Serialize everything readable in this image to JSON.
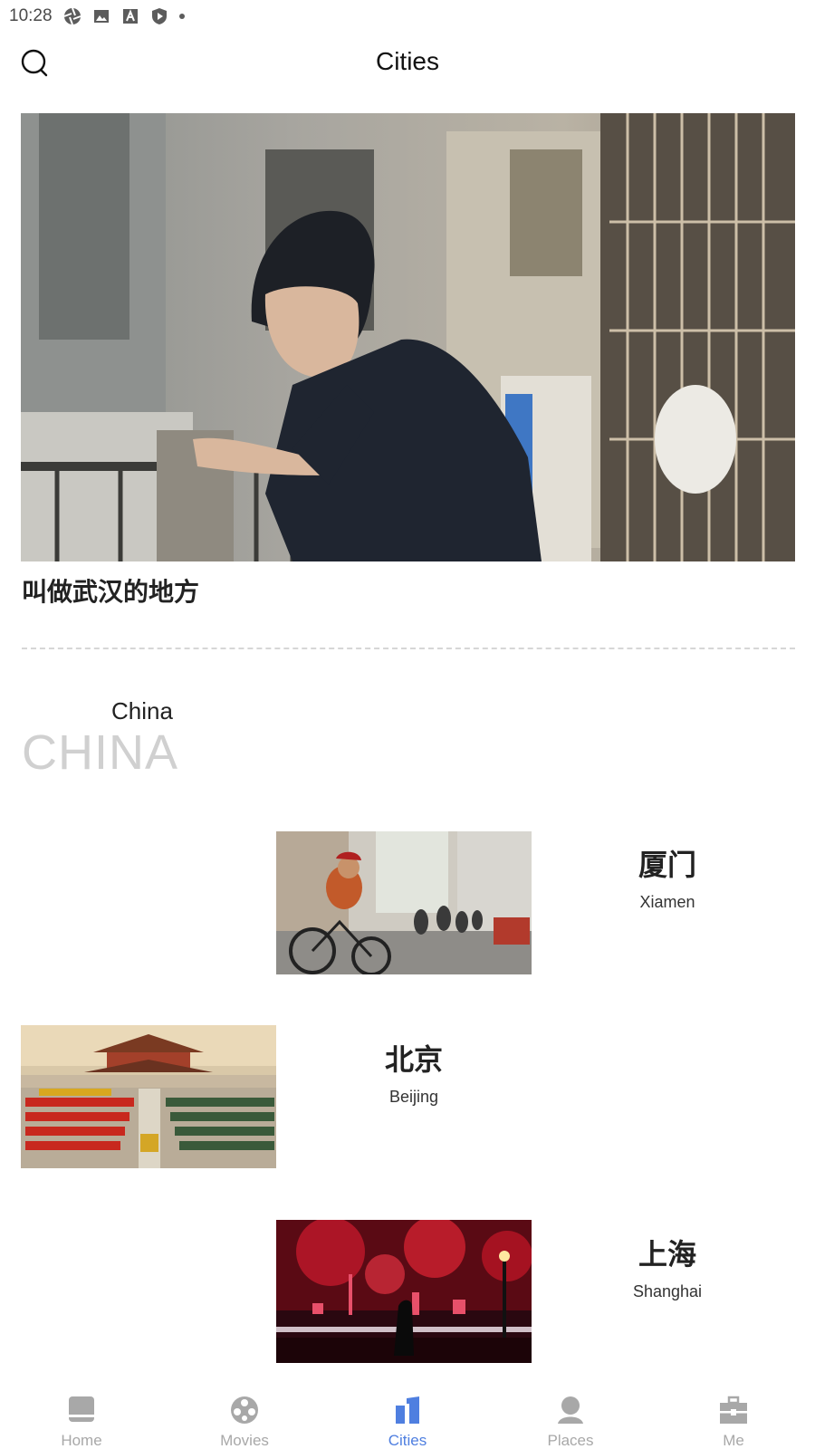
{
  "status_bar": {
    "time": "10:28",
    "icons": [
      "aperture-icon",
      "image-icon",
      "font-a-icon",
      "shield-icon",
      "dot-icon"
    ]
  },
  "header": {
    "title": "Cities",
    "search_icon": "search-icon"
  },
  "hero": {
    "caption": "叫做武汉的地方"
  },
  "section": {
    "label": "China",
    "watermark": "CHINA"
  },
  "cities": [
    {
      "name_cn": "厦门",
      "name_en": "Xiamen"
    },
    {
      "name_cn": "北京",
      "name_en": "Beijing"
    },
    {
      "name_cn": "上海",
      "name_en": "Shanghai"
    }
  ],
  "nav": {
    "items": [
      {
        "label": "Home",
        "icon": "home-icon"
      },
      {
        "label": "Movies",
        "icon": "film-reel-icon"
      },
      {
        "label": "Cities",
        "icon": "cities-icon"
      },
      {
        "label": "Places",
        "icon": "person-pin-icon"
      },
      {
        "label": "Me",
        "icon": "briefcase-icon"
      }
    ],
    "active": "Cities",
    "active_color": "#4f7fe0",
    "inactive_color": "#a8a8a8"
  }
}
